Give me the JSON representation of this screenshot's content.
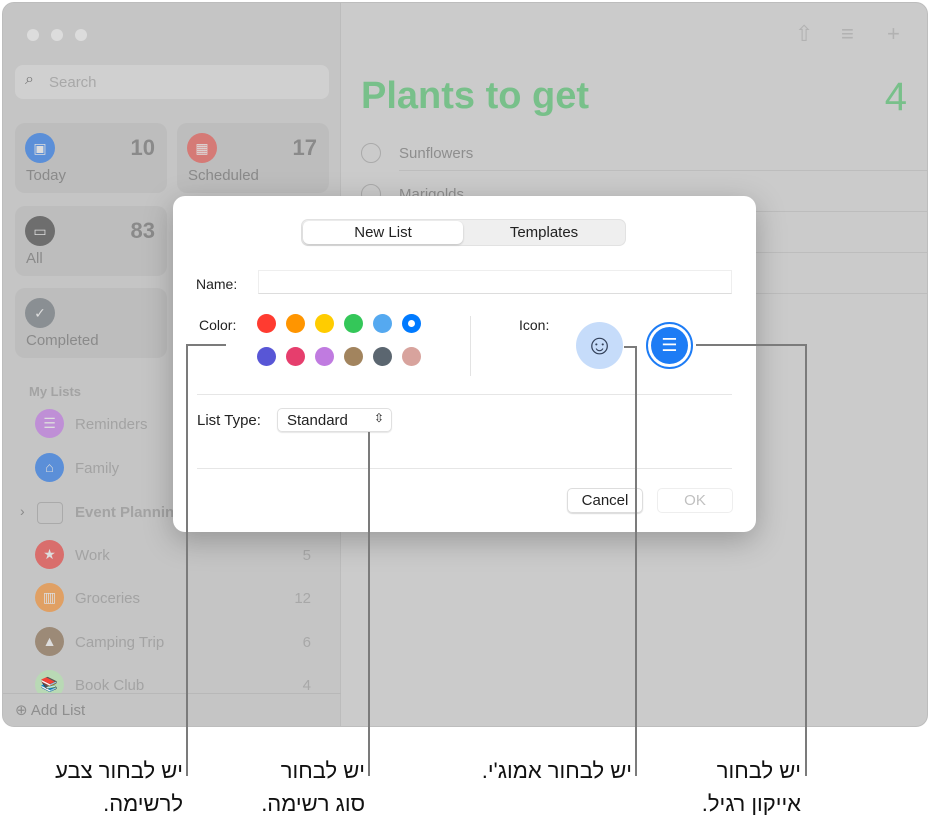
{
  "sidebar": {
    "search_placeholder": "Search",
    "smart_lists": [
      {
        "label": "Today",
        "count": "10",
        "icon": "calendar-today-icon",
        "color": "#5b8fd8"
      },
      {
        "label": "Scheduled",
        "count": "17",
        "icon": "calendar-icon",
        "color": "#d57a76"
      },
      {
        "label": "All",
        "count": "83",
        "icon": "tray-icon",
        "color": "#6e6e6e"
      },
      {
        "label": "Completed",
        "count": "",
        "icon": "checkmark-icon",
        "color": "#8a8f93"
      }
    ],
    "my_lists_header": "My Lists",
    "lists": [
      {
        "label": "Reminders",
        "count": "",
        "icon": "list-icon",
        "color": "#bf8fd6"
      },
      {
        "label": "Family",
        "count": "",
        "icon": "house-icon",
        "color": "#5b8fd8"
      },
      {
        "label": "Event Planning",
        "count": "",
        "icon": "folder-icon",
        "color": "none"
      },
      {
        "label": "Work",
        "count": "5",
        "icon": "star-icon",
        "color": "#d96e6c"
      },
      {
        "label": "Groceries",
        "count": "12",
        "icon": "basket-icon",
        "color": "#e0a064"
      },
      {
        "label": "Camping Trip",
        "count": "6",
        "icon": "tent-icon",
        "color": "#9c8a77"
      },
      {
        "label": "Book Club",
        "count": "4",
        "icon": "books-icon",
        "color": "#b9d9b5"
      }
    ],
    "add_list": "Add List"
  },
  "main": {
    "title": "Plants to get",
    "count": "4",
    "items": [
      "Sunflowers",
      "Marigolds"
    ],
    "accent": "#78c08a"
  },
  "dialog": {
    "tabs": [
      "New List",
      "Templates"
    ],
    "name_label": "Name:",
    "name_value": "",
    "color_label": "Color:",
    "colors": [
      "#ff3b30",
      "#ff9500",
      "#ffcc00",
      "#34c759",
      "#55a9f0",
      "#007aff",
      "#5856d6",
      "#e63e6d",
      "#c07be0",
      "#a2845e",
      "#5b6670",
      "#d8a39d"
    ],
    "selected_color": "#007aff",
    "icon_label": "Icon:",
    "list_type_label": "List Type:",
    "list_type_value": "Standard",
    "cancel": "Cancel",
    "ok": "OK"
  },
  "callouts": [
    {
      "line1": "יש לבחור צבע",
      "line2": "לרשימה."
    },
    {
      "line1": "יש לבחור",
      "line2": "סוג רשימה."
    },
    {
      "line1": "יש לבחור אמוג'י.",
      "line2": ""
    },
    {
      "line1": "יש לבחור",
      "line2": "אייקון רגיל."
    }
  ]
}
